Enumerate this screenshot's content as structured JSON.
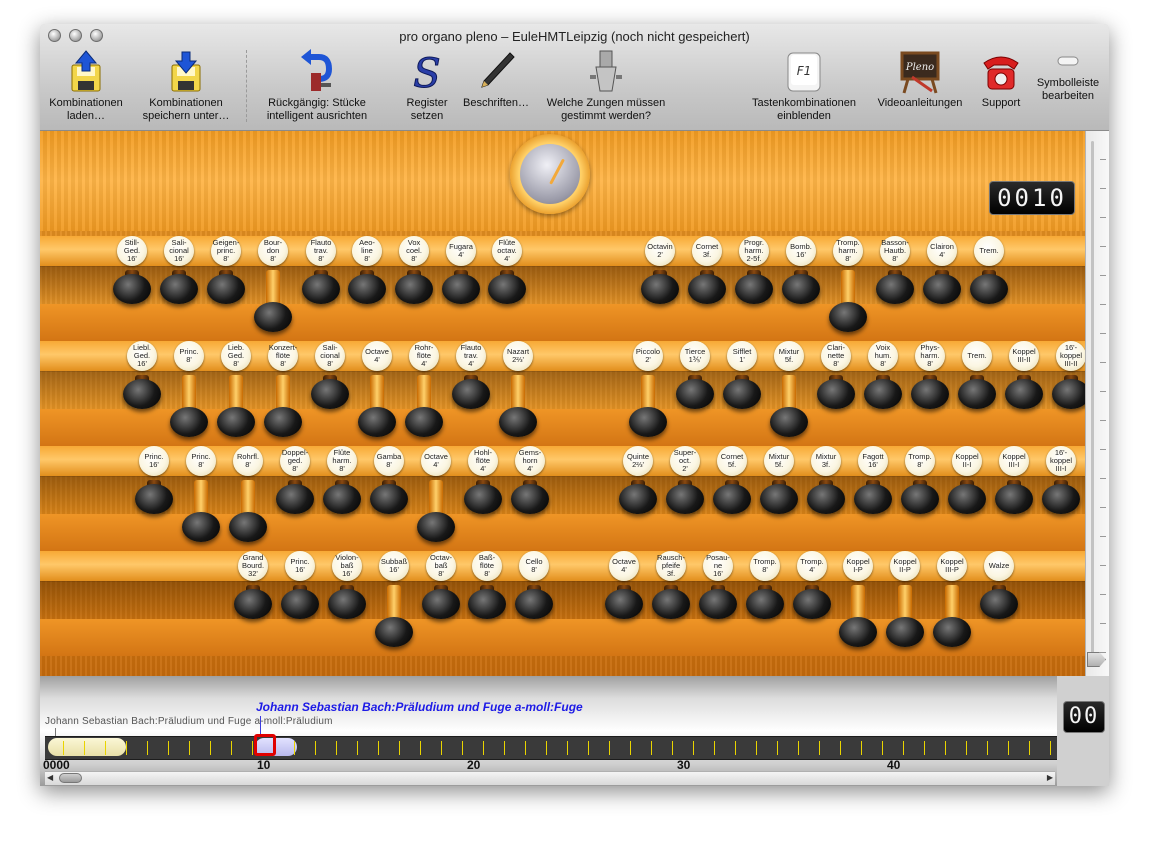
{
  "window": {
    "title": "pro organo pleno – EuleHMTLeipzig (noch nicht gespeichert)"
  },
  "toolbar": [
    {
      "id": "load",
      "label": "Kombinationen\nladen…",
      "icon": "load-combinations-icon"
    },
    {
      "id": "save",
      "label": "Kombinationen\nspeichern unter…",
      "icon": "save-combinations-icon"
    },
    {
      "id": "undo",
      "label": "Rückgängig: Stücke\nintelligent ausrichten",
      "icon": "undo-icon"
    },
    {
      "id": "registers",
      "label": "Register\nsetzen",
      "icon": "register-s-icon"
    },
    {
      "id": "caption",
      "label": "Beschriften…",
      "icon": "pen-icon"
    },
    {
      "id": "reeds",
      "label": "Welche Zungen müssen\ngestimmt werden?",
      "icon": "reed-pipe-icon"
    },
    {
      "id": "keys",
      "label": "Tastenkombinationen\neinblenden",
      "icon": "f1-key-icon",
      "key": "F1"
    },
    {
      "id": "videos",
      "label": "Videoanleitungen",
      "icon": "pleno-board-icon",
      "board": "Pleno"
    },
    {
      "id": "support",
      "label": "Support",
      "icon": "telephone-icon"
    },
    {
      "id": "customize",
      "label": "Symbolleiste\nbearbeiten",
      "icon": "toolbar-pill-icon"
    }
  ],
  "combination_counter": "0010",
  "rows": [
    [
      {
        "label": "Still-\nGed.\n16'",
        "pulled": false
      },
      {
        "label": "Sali-\ncional\n16'",
        "pulled": false
      },
      {
        "label": "Geigen-\nprinc.\n8'",
        "pulled": false
      },
      {
        "label": "Bour-\ndon\n8'",
        "pulled": true
      },
      {
        "label": "Flauto\ntrav.\n8'",
        "pulled": false
      },
      {
        "label": "Aeo-\nline\n8'",
        "pulled": false
      },
      {
        "label": "Vox\ncoel.\n8'",
        "pulled": false
      },
      {
        "label": "Fugara\n4'",
        "pulled": false
      },
      {
        "label": "Flûte\noctav.\n4'",
        "pulled": false
      },
      {
        "label": "Octavin\n2'",
        "pulled": false
      },
      {
        "label": "Cornet\n3f.",
        "pulled": false
      },
      {
        "label": "Progr.\nharm.\n2-5f.",
        "pulled": false
      },
      {
        "label": "Bomb.\n16'",
        "pulled": false
      },
      {
        "label": "Tromp.\nharm.\n8'",
        "pulled": true
      },
      {
        "label": "Basson-\nHautb.\n8'",
        "pulled": false
      },
      {
        "label": "Clairon\n4'",
        "pulled": false
      },
      {
        "label": "Trem.",
        "pulled": false
      }
    ],
    [
      {
        "label": "Liebl.\nGed.\n16'",
        "pulled": false
      },
      {
        "label": "Princ.\n8'",
        "pulled": true
      },
      {
        "label": "Lieb.\nGed.\n8'",
        "pulled": true
      },
      {
        "label": "Konzert-\nflöte\n8'",
        "pulled": true
      },
      {
        "label": "Sali-\ncional\n8'",
        "pulled": false
      },
      {
        "label": "Octave\n4'",
        "pulled": true
      },
      {
        "label": "Rohr-\nflöte\n4'",
        "pulled": true
      },
      {
        "label": "Flauto\ntrav.\n4'",
        "pulled": false
      },
      {
        "label": "Nazart\n2⅔'",
        "pulled": true
      },
      {
        "label": "Piccolo\n2'",
        "pulled": true
      },
      {
        "label": "Tierce\n1⅗'",
        "pulled": false
      },
      {
        "label": "Sifflet\n1'",
        "pulled": false
      },
      {
        "label": "Mixtur\n5f.",
        "pulled": true
      },
      {
        "label": "Clari-\nnette\n8'",
        "pulled": false
      },
      {
        "label": "Voix\nhum.\n8'",
        "pulled": false
      },
      {
        "label": "Phys-\nharm.\n8'",
        "pulled": false
      },
      {
        "label": "Trem.",
        "pulled": false
      },
      {
        "label": "Koppel\nIII-II",
        "pulled": false
      },
      {
        "label": "16'-\nkoppel\nIII-II",
        "pulled": false
      }
    ],
    [
      {
        "label": "Princ.\n16'",
        "pulled": false
      },
      {
        "label": "Princ.\n8'",
        "pulled": true
      },
      {
        "label": "Rohrfl.\n8'",
        "pulled": true
      },
      {
        "label": "Doppel-\nged.\n8'",
        "pulled": false
      },
      {
        "label": "Flûte\nharm.\n8'",
        "pulled": false
      },
      {
        "label": "Gamba\n8'",
        "pulled": false
      },
      {
        "label": "Octave\n4'",
        "pulled": true
      },
      {
        "label": "Hohl-\nflöte\n4'",
        "pulled": false
      },
      {
        "label": "Gems-\nhorn\n4'",
        "pulled": false
      },
      {
        "label": "Quinte\n2⅔'",
        "pulled": false
      },
      {
        "label": "Super-\noct.\n2'",
        "pulled": false
      },
      {
        "label": "Cornet\n5f.",
        "pulled": false
      },
      {
        "label": "Mixtur\n5f.",
        "pulled": false
      },
      {
        "label": "Mixtur\n3f.",
        "pulled": false
      },
      {
        "label": "Fagott\n16'",
        "pulled": false
      },
      {
        "label": "Tromp.\n8'",
        "pulled": false
      },
      {
        "label": "Koppel\nII-I",
        "pulled": false
      },
      {
        "label": "Koppel\nIII-I",
        "pulled": false
      },
      {
        "label": "16'-\nkoppel\nIII-I",
        "pulled": false
      }
    ],
    [
      {
        "label": "Grand\nBourd.\n32'",
        "pulled": false
      },
      {
        "label": "Princ.\n16'",
        "pulled": false
      },
      {
        "label": "Violon-\nbaß\n16'",
        "pulled": false
      },
      {
        "label": "Subbaß\n16'",
        "pulled": true
      },
      {
        "label": "Octav-\nbaß\n8'",
        "pulled": false
      },
      {
        "label": "Baß-\nflöte\n8'",
        "pulled": false
      },
      {
        "label": "Cello\n8'",
        "pulled": false
      },
      {
        "label": "Octave\n4'",
        "pulled": false
      },
      {
        "label": "Rausch-\npfeife\n3f.",
        "pulled": false
      },
      {
        "label": "Posau-\nne\n16'",
        "pulled": false
      },
      {
        "label": "Tromp.\n8'",
        "pulled": false
      },
      {
        "label": "Tromp.\n4'",
        "pulled": false
      },
      {
        "label": "Koppel\nI-P",
        "pulled": true
      },
      {
        "label": "Koppel\nII-P",
        "pulled": true
      },
      {
        "label": "Koppel\nIII-P",
        "pulled": true
      },
      {
        "label": "Walze",
        "pulled": false
      }
    ]
  ],
  "timeline": {
    "current_piece": "Johann Sebastian Bach:Präludium und Fuge a-moll:Fuge",
    "previous_piece": "Johann Sebastian Bach:Präludium und Fuge a-moll:Präludium",
    "numbers": [
      "0000",
      "10",
      "20",
      "30",
      "40"
    ],
    "position_counter": "00"
  }
}
